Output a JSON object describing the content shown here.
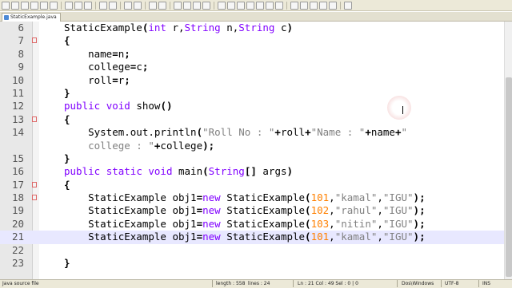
{
  "tab": {
    "label": "StaticExample.java"
  },
  "status": {
    "file_type": "Java source file",
    "length": "length : 558",
    "lines": "lines : 24",
    "position": "Ln : 21    Col : 49    Sel : 0 | 0",
    "eol": "Dos\\Windows",
    "encoding": "UTF-8",
    "mode": "INS"
  },
  "gutter": [
    "6",
    "7",
    "8",
    "9",
    "10",
    "11",
    "12",
    "13",
    "14",
    "",
    "15",
    "16",
    "17",
    "18",
    "19",
    "20",
    "21",
    "22",
    "23"
  ],
  "code": [
    "StaticExample(int r,String n,String c)",
    "{",
    "    name=n;",
    "    college=c;",
    "    roll=r;",
    "}",
    "public void show()",
    "{",
    "    System.out.println(\"Roll No : \"+roll+\"Name : \"+name+\"",
    "    college : \"+college);",
    "}",
    "public static void main(String[] args)",
    "{",
    "    StaticExample obj1=new StaticExample(101,\"kamal\",\"IGU\");",
    "    StaticExample obj1=new StaticExample(102,\"rahul\",\"IGU\");",
    "    StaticExample obj1=new StaticExample(103,\"nitin\",\"IGU\");",
    "    StaticExample obj1=new StaticExample(101,\"kamal\",\"IGU\");",
    "",
    "}"
  ],
  "current_line_index": 16,
  "fold_markers": [
    1,
    7,
    12,
    13
  ],
  "colors": {
    "keyword": "#8000ff",
    "string": "#808080",
    "number": "#ff8000",
    "current_line": "#e8e8ff"
  }
}
